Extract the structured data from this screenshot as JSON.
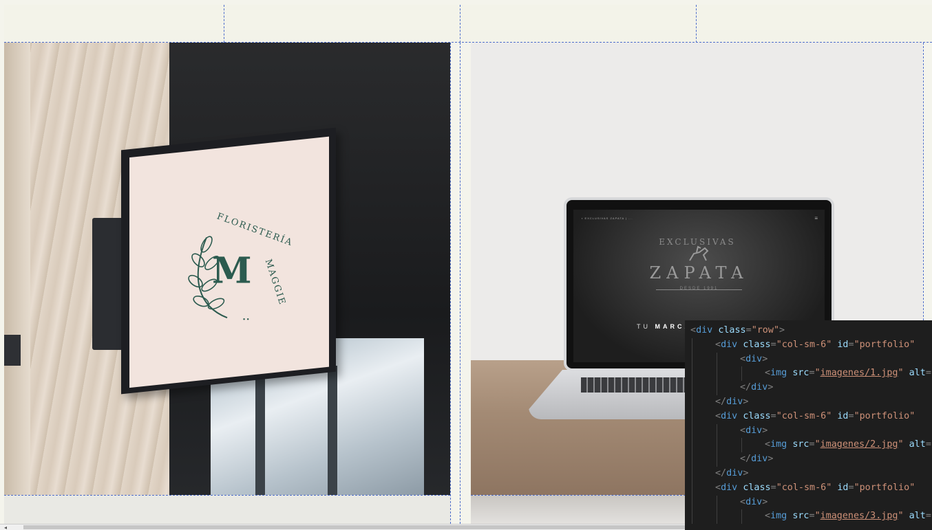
{
  "left_photo": {
    "sign_text": "FLORISTERÍA MAGGIE",
    "sign_text_a": "FLORISTERÍA",
    "sign_text_b": "MAGGIE",
    "sign_monogram": "M",
    "sign_dots": "• •"
  },
  "right_photo": {
    "arc_text": "EXCLUSIVAS",
    "brand": "ZAPATA",
    "since": "DESDE 1991",
    "tagline_prefix": "TU",
    "tagline_bold": "MARCA",
    "menu_icon": "≡"
  },
  "code_editor": {
    "lines": [
      {
        "indent": 0,
        "tag": "div",
        "attrs": [
          {
            "name": "class",
            "value": "row"
          }
        ],
        "close": ">"
      },
      {
        "indent": 1,
        "tag": "div",
        "attrs": [
          {
            "name": "class",
            "value": "col-sm-6"
          },
          {
            "name": "id",
            "value": "portfolio"
          }
        ],
        "close": ""
      },
      {
        "indent": 2,
        "tag": "div",
        "attrs": [],
        "close": ">"
      },
      {
        "indent": 3,
        "tag": "img",
        "attrs": [
          {
            "name": "src",
            "value": "imagenes/1.jpg",
            "link": true
          },
          {
            "name": "alt",
            "value": ""
          }
        ],
        "close": ""
      },
      {
        "indent": 2,
        "end_tag": "div"
      },
      {
        "indent": 1,
        "end_tag": "div"
      },
      {
        "indent": 1,
        "tag": "div",
        "attrs": [
          {
            "name": "class",
            "value": "col-sm-6"
          },
          {
            "name": "id",
            "value": "portfolio"
          }
        ],
        "close": ""
      },
      {
        "indent": 2,
        "tag": "div",
        "attrs": [],
        "close": ">"
      },
      {
        "indent": 3,
        "tag": "img",
        "attrs": [
          {
            "name": "src",
            "value": "imagenes/2.jpg",
            "link": true
          },
          {
            "name": "alt",
            "value": ""
          }
        ],
        "close": ""
      },
      {
        "indent": 2,
        "end_tag": "div"
      },
      {
        "indent": 1,
        "end_tag": "div"
      },
      {
        "indent": 1,
        "tag": "div",
        "attrs": [
          {
            "name": "class",
            "value": "col-sm-6"
          },
          {
            "name": "id",
            "value": "portfolio"
          }
        ],
        "close": ""
      },
      {
        "indent": 2,
        "tag": "div",
        "attrs": [],
        "close": ">"
      },
      {
        "indent": 3,
        "tag": "img",
        "attrs": [
          {
            "name": "src",
            "value": "imagenes/3.jpg",
            "link": true
          },
          {
            "name": "alt",
            "value": ""
          }
        ],
        "close": ""
      }
    ]
  },
  "scrollbar": {
    "left_arrow": "◂"
  },
  "colors": {
    "guide_line": "#4c6ccc",
    "code_bg": "#1e1e1e",
    "tag": "#569cd6",
    "attr": "#9cdcfe",
    "string": "#ce9178",
    "sign_green": "#2c5b4f"
  }
}
